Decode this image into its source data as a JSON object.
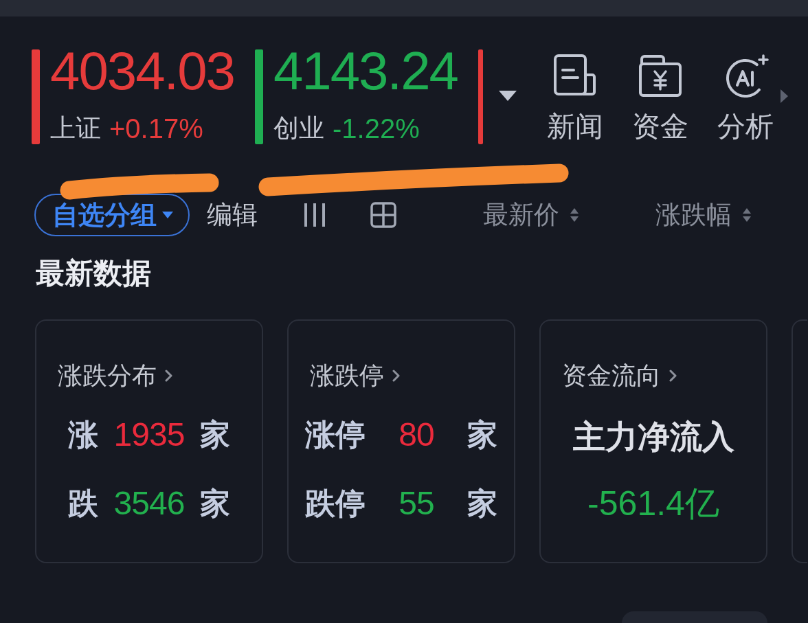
{
  "indices": [
    {
      "name": "上证",
      "value": "4034.03",
      "change": "+0.17%",
      "color": "#e63b3b"
    },
    {
      "name": "创业",
      "value": "4143.24",
      "change": "-1.22%",
      "color": "#1fae52"
    },
    {
      "color": "#e63b3b"
    }
  ],
  "shortcuts": [
    {
      "kind": "news",
      "label": "新闻"
    },
    {
      "kind": "funds",
      "label": "资金"
    },
    {
      "kind": "ai",
      "label": "分析"
    }
  ],
  "toolbar": {
    "group_button": {
      "label": "自选分组"
    },
    "edit_button": {
      "label": "编辑"
    },
    "sort_columns": [
      {
        "label": "最新价"
      },
      {
        "label": "涨跌幅"
      }
    ]
  },
  "section_title": "最新数据",
  "cards": [
    {
      "kind": "counts",
      "title": "涨跌分布",
      "rows": [
        {
          "label": "涨",
          "value": "1935",
          "unit": "家",
          "color": "#ea2a3c"
        },
        {
          "label": "跌",
          "value": "3546",
          "unit": "家",
          "color": "#22b04e"
        }
      ]
    },
    {
      "kind": "counts",
      "title": "涨跌停",
      "rows": [
        {
          "label": "涨停",
          "value": "80",
          "unit": "家",
          "color": "#ea2a3c"
        },
        {
          "label": "跌停",
          "value": "55",
          "unit": "家",
          "color": "#22b04e"
        }
      ]
    },
    {
      "kind": "flow",
      "title": "资金流向",
      "label": "主力净流入",
      "value": "-561.4亿",
      "color": "#22b04e"
    },
    {
      "kind": "partial"
    }
  ],
  "annotations": [
    {
      "kind": "marker"
    },
    {
      "kind": "marker"
    }
  ]
}
